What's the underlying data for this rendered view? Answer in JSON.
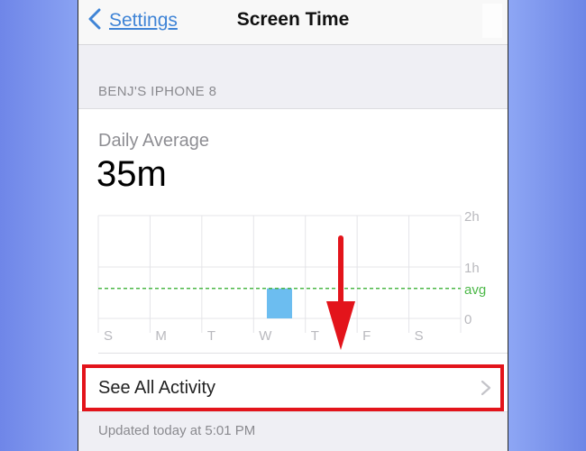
{
  "nav": {
    "back_label": "Settings",
    "title": "Screen Time"
  },
  "device_header": "BENJ'S IPHONE 8",
  "summary": {
    "label": "Daily Average",
    "value": "35m"
  },
  "chart_data": {
    "type": "bar",
    "categories": [
      "S",
      "M",
      "T",
      "W",
      "T",
      "F",
      "S"
    ],
    "values": [
      0,
      0,
      0,
      35,
      0,
      0,
      0
    ],
    "unit": "minutes",
    "ylim": [
      0,
      120
    ],
    "yticks": [
      {
        "label": "0",
        "value": 0
      },
      {
        "label": "1h",
        "value": 60
      },
      {
        "label": "2h",
        "value": 120
      }
    ],
    "average": {
      "label": "avg",
      "value": 35
    },
    "colors": {
      "bar": "#6cbdf0",
      "average": "#4cb848",
      "grid": "#e4e4e8",
      "axis_text": "#b9b9be"
    },
    "grid": true
  },
  "activity": {
    "label": "See All Activity"
  },
  "updated": "Updated today at 5:01 PM",
  "annotation": {
    "color": "#e3141b"
  }
}
